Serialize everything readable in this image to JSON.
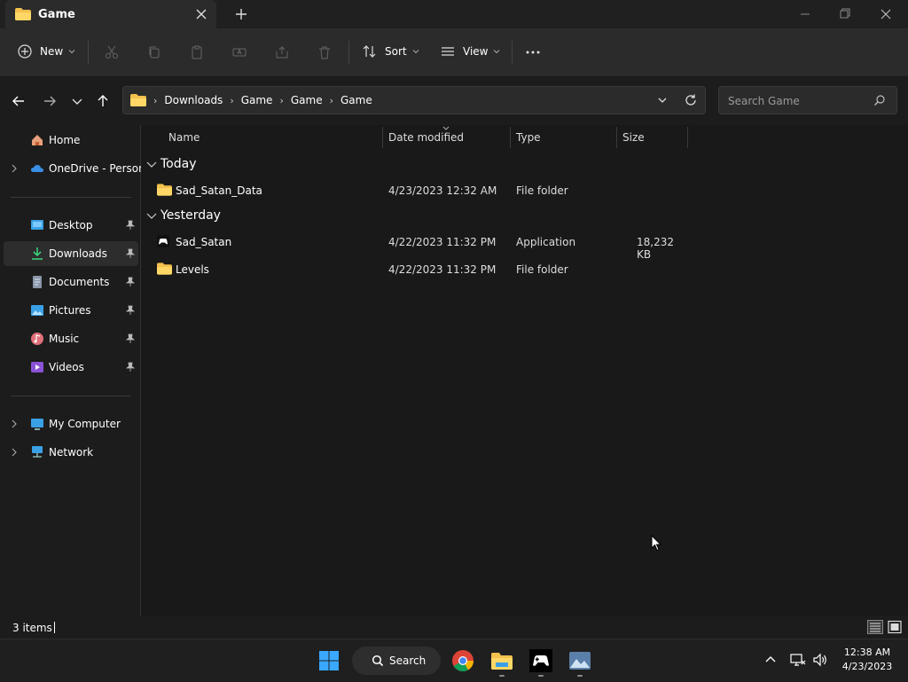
{
  "window": {
    "tab_title": "Game",
    "icons": {
      "tab": "folder-icon",
      "close": "close-icon",
      "new_tab": "plus-icon"
    }
  },
  "toolbar": {
    "new_label": "New",
    "sort_label": "Sort",
    "view_label": "View"
  },
  "navigation": {
    "breadcrumbs": [
      "Downloads",
      "Game",
      "Game",
      "Game"
    ],
    "search_placeholder": "Search Game"
  },
  "sidebar": {
    "items": [
      {
        "label": "Home"
      },
      {
        "label": "OneDrive - Persona"
      },
      {
        "label": "Desktop"
      },
      {
        "label": "Downloads"
      },
      {
        "label": "Documents"
      },
      {
        "label": "Pictures"
      },
      {
        "label": "Music"
      },
      {
        "label": "Videos"
      },
      {
        "label": "My Computer"
      },
      {
        "label": "Network"
      }
    ]
  },
  "columns": {
    "name": "Name",
    "date": "Date modified",
    "type": "Type",
    "size": "Size"
  },
  "groups": [
    {
      "label": "Today",
      "files": [
        {
          "name": "Sad_Satan_Data",
          "date": "4/23/2023 12:32 AM",
          "type": "File folder",
          "size": ""
        }
      ]
    },
    {
      "label": "Yesterday",
      "files": [
        {
          "name": "Sad_Satan",
          "date": "4/22/2023 11:32 PM",
          "type": "Application",
          "size": "18,232 KB"
        },
        {
          "name": "Levels",
          "date": "4/22/2023 11:32 PM",
          "type": "File folder",
          "size": ""
        }
      ]
    }
  ],
  "status": {
    "items_text": "3 items"
  },
  "taskbar": {
    "search_label": "Search",
    "time": "12:38 AM",
    "date": "4/23/2023"
  },
  "colors": {
    "folder": "#f2c14e",
    "accent": "#4cc2ff",
    "background": "#191919"
  }
}
